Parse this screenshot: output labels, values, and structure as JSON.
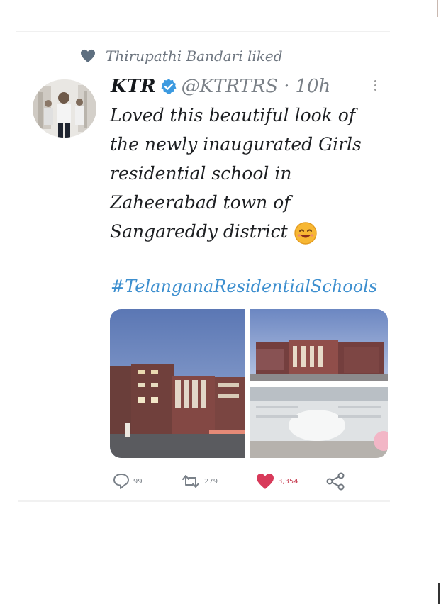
{
  "social_context": {
    "text": "Thirupathi Bandari liked",
    "icon": "heart-icon",
    "icon_color": "#5e6f80"
  },
  "tweet": {
    "author_name": "KTR",
    "verified": true,
    "handle": "@KTRTRS",
    "separator": "·",
    "time": "10h",
    "body_lines": [
      "Loved this beautiful look of",
      "the newly inaugurated Girls",
      "residential school in",
      "Zaheerabad town of",
      "Sangareddy district"
    ],
    "emoji": "smiling-face-emoji",
    "hashtag": "#TelanganaResidentialSchools",
    "media_count": 3
  },
  "actions": {
    "reply_count": "99",
    "retweet_count": "279",
    "like_count": "3,354",
    "like_color": "#d83a5a",
    "link_color": "#3d8fcf"
  }
}
